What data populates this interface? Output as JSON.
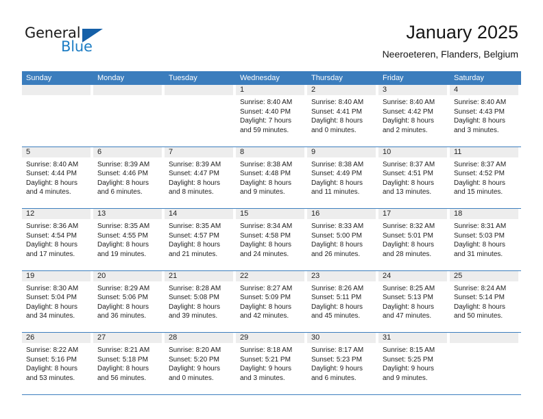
{
  "brand": {
    "name_part1": "General",
    "name_part2": "Blue",
    "triangle_color": "#1560a8",
    "blue_text_color": "#1d7dc4"
  },
  "header": {
    "title": "January 2025",
    "subtitle": "Neeroeteren, Flanders, Belgium"
  },
  "theme": {
    "header_row_bg": "#3b7dbd",
    "daynum_bg": "#ededed",
    "row_divider": "#3b7dbd",
    "text": "#1c1c1c"
  },
  "weekdays": [
    "Sunday",
    "Monday",
    "Tuesday",
    "Wednesday",
    "Thursday",
    "Friday",
    "Saturday"
  ],
  "weeks": [
    [
      {
        "day": "",
        "sunrise": "",
        "sunset": "",
        "daylight1": "",
        "daylight2": "",
        "empty": true
      },
      {
        "day": "",
        "sunrise": "",
        "sunset": "",
        "daylight1": "",
        "daylight2": "",
        "empty": true
      },
      {
        "day": "",
        "sunrise": "",
        "sunset": "",
        "daylight1": "",
        "daylight2": "",
        "empty": true
      },
      {
        "day": "1",
        "sunrise": "Sunrise: 8:40 AM",
        "sunset": "Sunset: 4:40 PM",
        "daylight1": "Daylight: 7 hours",
        "daylight2": "and 59 minutes.",
        "empty": false
      },
      {
        "day": "2",
        "sunrise": "Sunrise: 8:40 AM",
        "sunset": "Sunset: 4:41 PM",
        "daylight1": "Daylight: 8 hours",
        "daylight2": "and 0 minutes.",
        "empty": false
      },
      {
        "day": "3",
        "sunrise": "Sunrise: 8:40 AM",
        "sunset": "Sunset: 4:42 PM",
        "daylight1": "Daylight: 8 hours",
        "daylight2": "and 2 minutes.",
        "empty": false
      },
      {
        "day": "4",
        "sunrise": "Sunrise: 8:40 AM",
        "sunset": "Sunset: 4:43 PM",
        "daylight1": "Daylight: 8 hours",
        "daylight2": "and 3 minutes.",
        "empty": false
      }
    ],
    [
      {
        "day": "5",
        "sunrise": "Sunrise: 8:40 AM",
        "sunset": "Sunset: 4:44 PM",
        "daylight1": "Daylight: 8 hours",
        "daylight2": "and 4 minutes.",
        "empty": false
      },
      {
        "day": "6",
        "sunrise": "Sunrise: 8:39 AM",
        "sunset": "Sunset: 4:46 PM",
        "daylight1": "Daylight: 8 hours",
        "daylight2": "and 6 minutes.",
        "empty": false
      },
      {
        "day": "7",
        "sunrise": "Sunrise: 8:39 AM",
        "sunset": "Sunset: 4:47 PM",
        "daylight1": "Daylight: 8 hours",
        "daylight2": "and 8 minutes.",
        "empty": false
      },
      {
        "day": "8",
        "sunrise": "Sunrise: 8:38 AM",
        "sunset": "Sunset: 4:48 PM",
        "daylight1": "Daylight: 8 hours",
        "daylight2": "and 9 minutes.",
        "empty": false
      },
      {
        "day": "9",
        "sunrise": "Sunrise: 8:38 AM",
        "sunset": "Sunset: 4:49 PM",
        "daylight1": "Daylight: 8 hours",
        "daylight2": "and 11 minutes.",
        "empty": false
      },
      {
        "day": "10",
        "sunrise": "Sunrise: 8:37 AM",
        "sunset": "Sunset: 4:51 PM",
        "daylight1": "Daylight: 8 hours",
        "daylight2": "and 13 minutes.",
        "empty": false
      },
      {
        "day": "11",
        "sunrise": "Sunrise: 8:37 AM",
        "sunset": "Sunset: 4:52 PM",
        "daylight1": "Daylight: 8 hours",
        "daylight2": "and 15 minutes.",
        "empty": false
      }
    ],
    [
      {
        "day": "12",
        "sunrise": "Sunrise: 8:36 AM",
        "sunset": "Sunset: 4:54 PM",
        "daylight1": "Daylight: 8 hours",
        "daylight2": "and 17 minutes.",
        "empty": false
      },
      {
        "day": "13",
        "sunrise": "Sunrise: 8:35 AM",
        "sunset": "Sunset: 4:55 PM",
        "daylight1": "Daylight: 8 hours",
        "daylight2": "and 19 minutes.",
        "empty": false
      },
      {
        "day": "14",
        "sunrise": "Sunrise: 8:35 AM",
        "sunset": "Sunset: 4:57 PM",
        "daylight1": "Daylight: 8 hours",
        "daylight2": "and 21 minutes.",
        "empty": false
      },
      {
        "day": "15",
        "sunrise": "Sunrise: 8:34 AM",
        "sunset": "Sunset: 4:58 PM",
        "daylight1": "Daylight: 8 hours",
        "daylight2": "and 24 minutes.",
        "empty": false
      },
      {
        "day": "16",
        "sunrise": "Sunrise: 8:33 AM",
        "sunset": "Sunset: 5:00 PM",
        "daylight1": "Daylight: 8 hours",
        "daylight2": "and 26 minutes.",
        "empty": false
      },
      {
        "day": "17",
        "sunrise": "Sunrise: 8:32 AM",
        "sunset": "Sunset: 5:01 PM",
        "daylight1": "Daylight: 8 hours",
        "daylight2": "and 28 minutes.",
        "empty": false
      },
      {
        "day": "18",
        "sunrise": "Sunrise: 8:31 AM",
        "sunset": "Sunset: 5:03 PM",
        "daylight1": "Daylight: 8 hours",
        "daylight2": "and 31 minutes.",
        "empty": false
      }
    ],
    [
      {
        "day": "19",
        "sunrise": "Sunrise: 8:30 AM",
        "sunset": "Sunset: 5:04 PM",
        "daylight1": "Daylight: 8 hours",
        "daylight2": "and 34 minutes.",
        "empty": false
      },
      {
        "day": "20",
        "sunrise": "Sunrise: 8:29 AM",
        "sunset": "Sunset: 5:06 PM",
        "daylight1": "Daylight: 8 hours",
        "daylight2": "and 36 minutes.",
        "empty": false
      },
      {
        "day": "21",
        "sunrise": "Sunrise: 8:28 AM",
        "sunset": "Sunset: 5:08 PM",
        "daylight1": "Daylight: 8 hours",
        "daylight2": "and 39 minutes.",
        "empty": false
      },
      {
        "day": "22",
        "sunrise": "Sunrise: 8:27 AM",
        "sunset": "Sunset: 5:09 PM",
        "daylight1": "Daylight: 8 hours",
        "daylight2": "and 42 minutes.",
        "empty": false
      },
      {
        "day": "23",
        "sunrise": "Sunrise: 8:26 AM",
        "sunset": "Sunset: 5:11 PM",
        "daylight1": "Daylight: 8 hours",
        "daylight2": "and 45 minutes.",
        "empty": false
      },
      {
        "day": "24",
        "sunrise": "Sunrise: 8:25 AM",
        "sunset": "Sunset: 5:13 PM",
        "daylight1": "Daylight: 8 hours",
        "daylight2": "and 47 minutes.",
        "empty": false
      },
      {
        "day": "25",
        "sunrise": "Sunrise: 8:24 AM",
        "sunset": "Sunset: 5:14 PM",
        "daylight1": "Daylight: 8 hours",
        "daylight2": "and 50 minutes.",
        "empty": false
      }
    ],
    [
      {
        "day": "26",
        "sunrise": "Sunrise: 8:22 AM",
        "sunset": "Sunset: 5:16 PM",
        "daylight1": "Daylight: 8 hours",
        "daylight2": "and 53 minutes.",
        "empty": false
      },
      {
        "day": "27",
        "sunrise": "Sunrise: 8:21 AM",
        "sunset": "Sunset: 5:18 PM",
        "daylight1": "Daylight: 8 hours",
        "daylight2": "and 56 minutes.",
        "empty": false
      },
      {
        "day": "28",
        "sunrise": "Sunrise: 8:20 AM",
        "sunset": "Sunset: 5:20 PM",
        "daylight1": "Daylight: 9 hours",
        "daylight2": "and 0 minutes.",
        "empty": false
      },
      {
        "day": "29",
        "sunrise": "Sunrise: 8:18 AM",
        "sunset": "Sunset: 5:21 PM",
        "daylight1": "Daylight: 9 hours",
        "daylight2": "and 3 minutes.",
        "empty": false
      },
      {
        "day": "30",
        "sunrise": "Sunrise: 8:17 AM",
        "sunset": "Sunset: 5:23 PM",
        "daylight1": "Daylight: 9 hours",
        "daylight2": "and 6 minutes.",
        "empty": false
      },
      {
        "day": "31",
        "sunrise": "Sunrise: 8:15 AM",
        "sunset": "Sunset: 5:25 PM",
        "daylight1": "Daylight: 9 hours",
        "daylight2": "and 9 minutes.",
        "empty": false
      },
      {
        "day": "",
        "sunrise": "",
        "sunset": "",
        "daylight1": "",
        "daylight2": "",
        "empty": true
      }
    ]
  ]
}
